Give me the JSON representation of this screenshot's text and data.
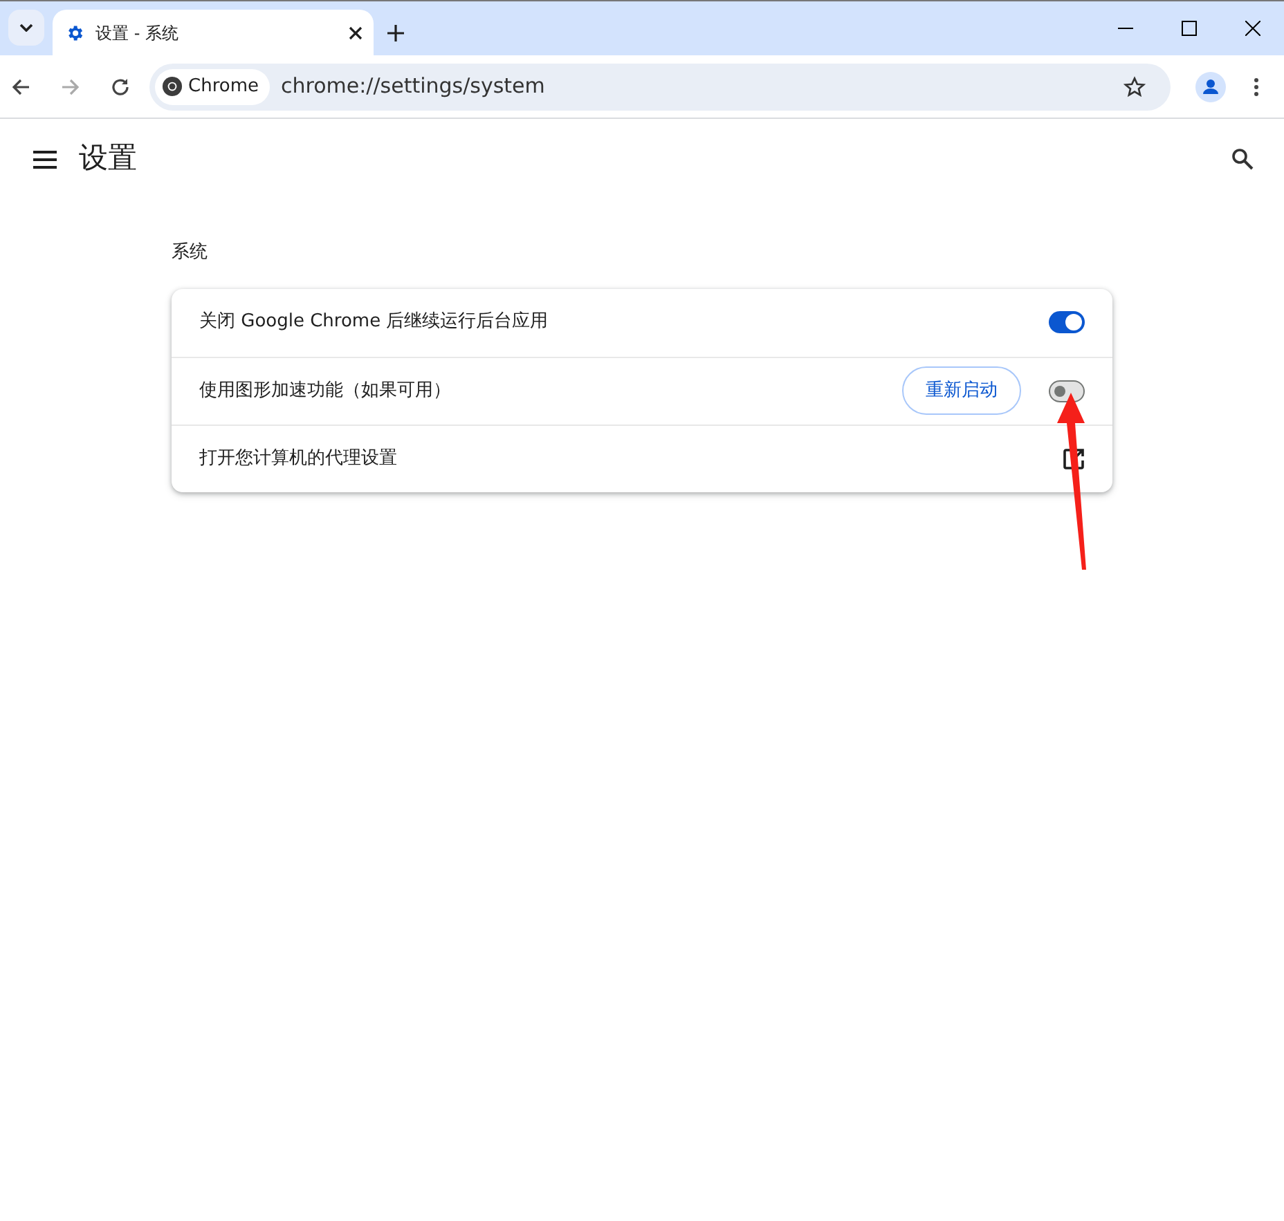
{
  "tab": {
    "title": "设置 - 系统",
    "selected": true
  },
  "address_bar": {
    "chip": "Chrome",
    "url": "chrome://settings/system"
  },
  "header": {
    "title": "设置"
  },
  "section": {
    "title": "系统"
  },
  "rows": [
    {
      "kind": "toggle",
      "label": "关闭 Google Chrome 后继续运行后台应用",
      "on": true
    },
    {
      "kind": "toggle",
      "label": "使用图形加速功能（如果可用）",
      "on": false,
      "button": "重新启动"
    },
    {
      "kind": "link",
      "label": "打开您计算机的代理设置"
    }
  ]
}
